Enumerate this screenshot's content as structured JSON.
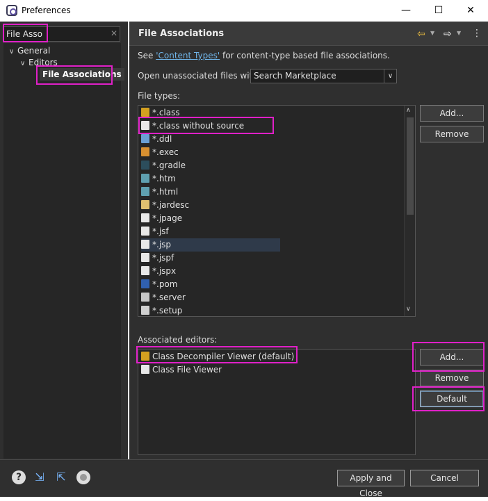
{
  "window": {
    "title": "Preferences",
    "minimize": "—",
    "maximize": "☐",
    "close": "✕"
  },
  "filter": {
    "value": "File Asso",
    "clear": "✕"
  },
  "tree": {
    "general": "General",
    "editors": "Editors",
    "file_associations": "File Associations"
  },
  "page": {
    "title": "File Associations",
    "see_prefix": "See ",
    "see_link": "'Content Types'",
    "see_suffix": " for content-type based file associations.",
    "open_label": "Open unassociated files with:",
    "open_value": "Search Marketplace",
    "file_types_label": "File types:",
    "associated_editors_label": "Associated editors:"
  },
  "file_types": [
    {
      "label": "*.class",
      "icon": "class-icon",
      "color": "#d4a020"
    },
    {
      "label": "*.class without source",
      "icon": "class-file-icon",
      "color": "#e8e8e8"
    },
    {
      "label": "*.ddl",
      "icon": "ddl-icon",
      "color": "#6a9fd4"
    },
    {
      "label": "*.exec",
      "icon": "exec-icon",
      "color": "#d89030"
    },
    {
      "label": "*.gradle",
      "icon": "gradle-icon",
      "color": "#2c4d5c"
    },
    {
      "label": "*.htm",
      "icon": "globe-icon",
      "color": "#5fa0b0"
    },
    {
      "label": "*.html",
      "icon": "globe-icon",
      "color": "#5fa0b0"
    },
    {
      "label": "*.jardesc",
      "icon": "jar-icon",
      "color": "#e0c070"
    },
    {
      "label": "*.jpage",
      "icon": "jpage-icon",
      "color": "#e8e8e8"
    },
    {
      "label": "*.jsf",
      "icon": "file-icon",
      "color": "#e8e8e8"
    },
    {
      "label": "*.jsp",
      "icon": "file-icon",
      "color": "#e8e8e8"
    },
    {
      "label": "*.jspf",
      "icon": "file-icon",
      "color": "#e8e8e8"
    },
    {
      "label": "*.jspx",
      "icon": "file-icon",
      "color": "#e8e8e8"
    },
    {
      "label": "*.pom",
      "icon": "maven-icon",
      "color": "#3060b0"
    },
    {
      "label": "*.server",
      "icon": "server-icon",
      "color": "#c8c8c8"
    },
    {
      "label": "*.setup",
      "icon": "setup-icon",
      "color": "#d0d0d0"
    }
  ],
  "editors": [
    {
      "label": "Class Decompiler Viewer (default)",
      "icon": "decompiler-icon",
      "color": "#d4a020"
    },
    {
      "label": "Class File Viewer",
      "icon": "class-file-icon",
      "color": "#e8e8e8"
    }
  ],
  "buttons": {
    "types_add": "Add...",
    "types_remove": "Remove",
    "editors_add": "Add...",
    "editors_remove": "Remove",
    "editors_default": "Default",
    "apply_close": "Apply and Close",
    "cancel": "Cancel"
  },
  "bottom_icons": [
    "help-icon",
    "import-icon",
    "export-icon",
    "oomph-icon"
  ],
  "colors": {
    "highlight": "#e020c8",
    "link": "#6fb4e8",
    "nav_arrow": "#f0c040"
  }
}
